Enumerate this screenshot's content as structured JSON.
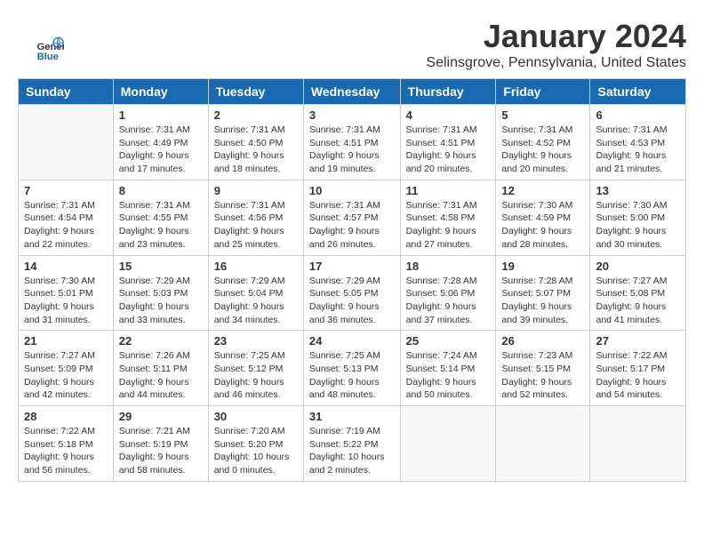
{
  "header": {
    "title": "January 2024",
    "subtitle": "Selinsgrove, Pennsylvania, United States",
    "logo_line1": "General",
    "logo_line2": "Blue"
  },
  "days_of_week": [
    "Sunday",
    "Monday",
    "Tuesday",
    "Wednesday",
    "Thursday",
    "Friday",
    "Saturday"
  ],
  "weeks": [
    [
      {
        "day": "",
        "info": ""
      },
      {
        "day": "1",
        "info": "Sunrise: 7:31 AM\nSunset: 4:49 PM\nDaylight: 9 hours\nand 17 minutes."
      },
      {
        "day": "2",
        "info": "Sunrise: 7:31 AM\nSunset: 4:50 PM\nDaylight: 9 hours\nand 18 minutes."
      },
      {
        "day": "3",
        "info": "Sunrise: 7:31 AM\nSunset: 4:51 PM\nDaylight: 9 hours\nand 19 minutes."
      },
      {
        "day": "4",
        "info": "Sunrise: 7:31 AM\nSunset: 4:51 PM\nDaylight: 9 hours\nand 20 minutes."
      },
      {
        "day": "5",
        "info": "Sunrise: 7:31 AM\nSunset: 4:52 PM\nDaylight: 9 hours\nand 20 minutes."
      },
      {
        "day": "6",
        "info": "Sunrise: 7:31 AM\nSunset: 4:53 PM\nDaylight: 9 hours\nand 21 minutes."
      }
    ],
    [
      {
        "day": "7",
        "info": "Sunrise: 7:31 AM\nSunset: 4:54 PM\nDaylight: 9 hours\nand 22 minutes."
      },
      {
        "day": "8",
        "info": "Sunrise: 7:31 AM\nSunset: 4:55 PM\nDaylight: 9 hours\nand 23 minutes."
      },
      {
        "day": "9",
        "info": "Sunrise: 7:31 AM\nSunset: 4:56 PM\nDaylight: 9 hours\nand 25 minutes."
      },
      {
        "day": "10",
        "info": "Sunrise: 7:31 AM\nSunset: 4:57 PM\nDaylight: 9 hours\nand 26 minutes."
      },
      {
        "day": "11",
        "info": "Sunrise: 7:31 AM\nSunset: 4:58 PM\nDaylight: 9 hours\nand 27 minutes."
      },
      {
        "day": "12",
        "info": "Sunrise: 7:30 AM\nSunset: 4:59 PM\nDaylight: 9 hours\nand 28 minutes."
      },
      {
        "day": "13",
        "info": "Sunrise: 7:30 AM\nSunset: 5:00 PM\nDaylight: 9 hours\nand 30 minutes."
      }
    ],
    [
      {
        "day": "14",
        "info": "Sunrise: 7:30 AM\nSunset: 5:01 PM\nDaylight: 9 hours\nand 31 minutes."
      },
      {
        "day": "15",
        "info": "Sunrise: 7:29 AM\nSunset: 5:03 PM\nDaylight: 9 hours\nand 33 minutes."
      },
      {
        "day": "16",
        "info": "Sunrise: 7:29 AM\nSunset: 5:04 PM\nDaylight: 9 hours\nand 34 minutes."
      },
      {
        "day": "17",
        "info": "Sunrise: 7:29 AM\nSunset: 5:05 PM\nDaylight: 9 hours\nand 36 minutes."
      },
      {
        "day": "18",
        "info": "Sunrise: 7:28 AM\nSunset: 5:06 PM\nDaylight: 9 hours\nand 37 minutes."
      },
      {
        "day": "19",
        "info": "Sunrise: 7:28 AM\nSunset: 5:07 PM\nDaylight: 9 hours\nand 39 minutes."
      },
      {
        "day": "20",
        "info": "Sunrise: 7:27 AM\nSunset: 5:08 PM\nDaylight: 9 hours\nand 41 minutes."
      }
    ],
    [
      {
        "day": "21",
        "info": "Sunrise: 7:27 AM\nSunset: 5:09 PM\nDaylight: 9 hours\nand 42 minutes."
      },
      {
        "day": "22",
        "info": "Sunrise: 7:26 AM\nSunset: 5:11 PM\nDaylight: 9 hours\nand 44 minutes."
      },
      {
        "day": "23",
        "info": "Sunrise: 7:25 AM\nSunset: 5:12 PM\nDaylight: 9 hours\nand 46 minutes."
      },
      {
        "day": "24",
        "info": "Sunrise: 7:25 AM\nSunset: 5:13 PM\nDaylight: 9 hours\nand 48 minutes."
      },
      {
        "day": "25",
        "info": "Sunrise: 7:24 AM\nSunset: 5:14 PM\nDaylight: 9 hours\nand 50 minutes."
      },
      {
        "day": "26",
        "info": "Sunrise: 7:23 AM\nSunset: 5:15 PM\nDaylight: 9 hours\nand 52 minutes."
      },
      {
        "day": "27",
        "info": "Sunrise: 7:22 AM\nSunset: 5:17 PM\nDaylight: 9 hours\nand 54 minutes."
      }
    ],
    [
      {
        "day": "28",
        "info": "Sunrise: 7:22 AM\nSunset: 5:18 PM\nDaylight: 9 hours\nand 56 minutes."
      },
      {
        "day": "29",
        "info": "Sunrise: 7:21 AM\nSunset: 5:19 PM\nDaylight: 9 hours\nand 58 minutes."
      },
      {
        "day": "30",
        "info": "Sunrise: 7:20 AM\nSunset: 5:20 PM\nDaylight: 10 hours\nand 0 minutes."
      },
      {
        "day": "31",
        "info": "Sunrise: 7:19 AM\nSunset: 5:22 PM\nDaylight: 10 hours\nand 2 minutes."
      },
      {
        "day": "",
        "info": ""
      },
      {
        "day": "",
        "info": ""
      },
      {
        "day": "",
        "info": ""
      }
    ]
  ]
}
